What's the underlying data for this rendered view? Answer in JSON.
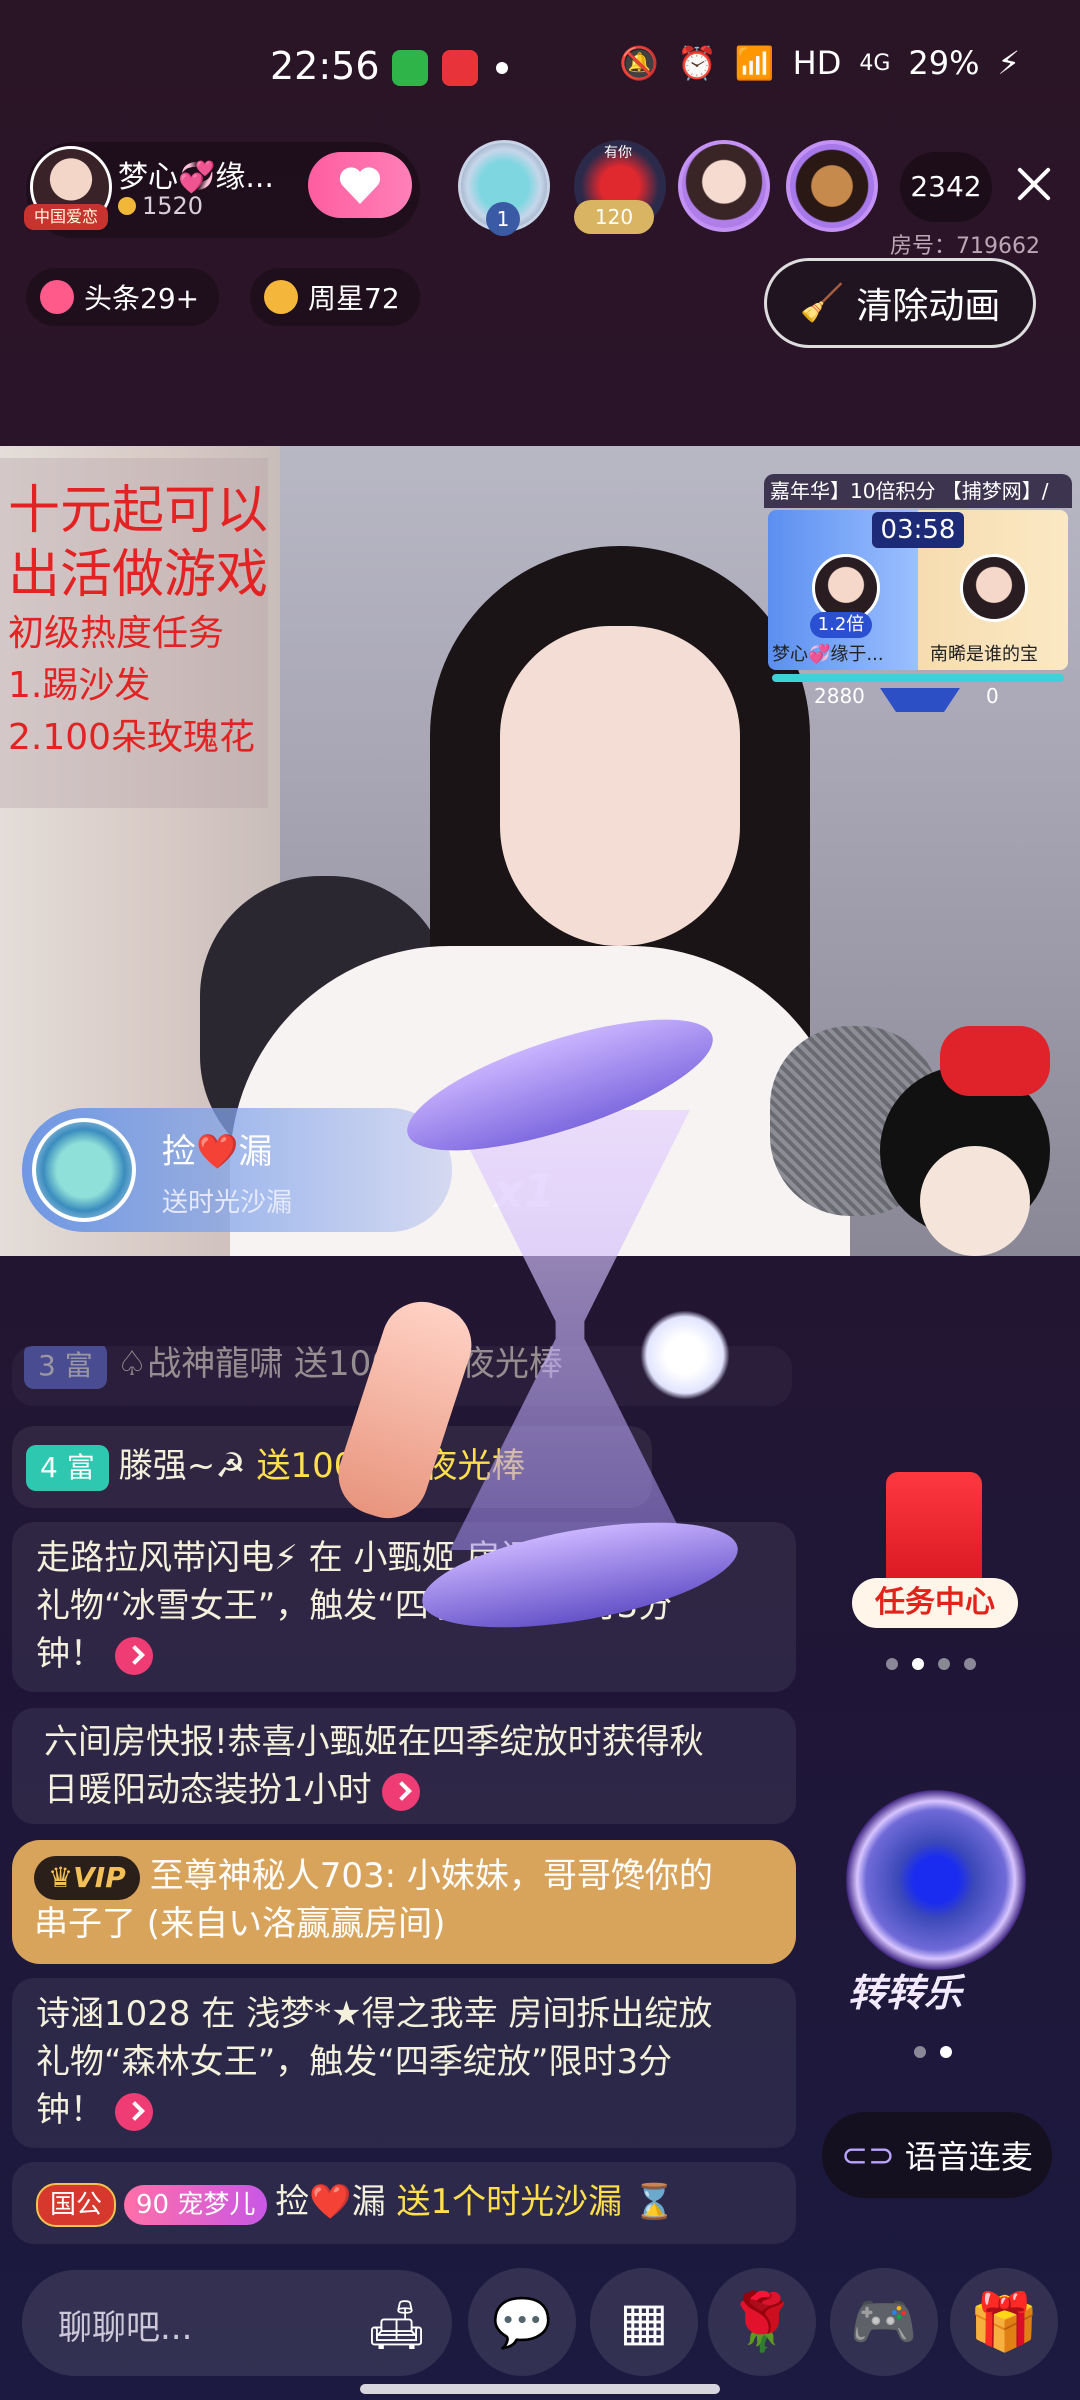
{
  "status_bar": {
    "time": "22:56",
    "network": "HD",
    "signal": "4G",
    "battery": "29%",
    "icons": [
      "mute-icon",
      "alarm-icon",
      "wifi-icon",
      "signal-icon",
      "battery-charging-icon"
    ]
  },
  "host": {
    "name": "梦心💞缘...",
    "tag": "中国爱恋",
    "coins": "1520"
  },
  "viewers": {
    "badge_1": "1",
    "badge_2": "120",
    "badge_2_top": "有你",
    "count": "2342"
  },
  "room": {
    "number_label": "房号：719662"
  },
  "chips": {
    "headline": "头条29+",
    "weekly_star": "周星72",
    "clear_animation": "清除动画"
  },
  "promo": {
    "line1": "十元起可以",
    "line2": "出活做游戏",
    "line3": "初级热度任务",
    "line4": "1.踢沙发",
    "line5": "2.100朵玫瑰花"
  },
  "pk": {
    "header": "嘉年华】10倍积分  【捕梦网】/",
    "timer": "03:58",
    "multiplier": "1.2倍",
    "left_name": "梦心💞缘于...",
    "right_name": "南晞是谁的宝",
    "left_score": "2880",
    "right_score": "0"
  },
  "gift_notice": {
    "name": "捡❤️漏",
    "subtitle": "送时光沙漏",
    "multiplier": "x1"
  },
  "chat": [
    {
      "id": "row0",
      "text": "♤战神龍啸 送100个小夜光棒",
      "level": "3 富"
    },
    {
      "id": "row1",
      "level": "4 富",
      "user": "滕强~☭",
      "gift": "送100个小夜光棒"
    },
    {
      "id": "row2",
      "line1": "走路拉风带闪电⚡ 在 小甄姬 房间拆出绽放",
      "line2": "礼物“冰雪女王”，触发“四季绽放”限时3分",
      "line3": "钟！"
    },
    {
      "id": "row3",
      "line1": "六间房快报!恭喜小甄姬在四季绽放时获得秋",
      "line2": "日暖阳动态装扮1小时"
    },
    {
      "id": "row4",
      "vip": "VIP",
      "line1": "至尊神秘人703: 小妹妹，哥哥馋你的",
      "line2": "串子了 (来自い洛赢赢房间)"
    },
    {
      "id": "row5",
      "line1": "诗涵1028 在 浅梦*★得之我幸 房间拆出绽放",
      "line2": "礼物“森林女王”，触发“四季绽放”限时3分",
      "line3": "钟！"
    },
    {
      "id": "row6",
      "tag1": "国公",
      "tag2_level": "90",
      "tag2": "宠梦儿",
      "user": "捡❤️漏",
      "gift": "送1个时光沙漏"
    }
  ],
  "side": {
    "task_center": "任务中心",
    "wheel": "转转乐",
    "voice_link": "语音连麦"
  },
  "input": {
    "placeholder": "聊聊吧..."
  },
  "colors": {
    "accent_pink": "#ff5da0",
    "gold_text": "#ffe04a",
    "vip_bg": "#d8a45c",
    "level_badge": "#2ec8b0",
    "promo_red": "#e32323"
  }
}
